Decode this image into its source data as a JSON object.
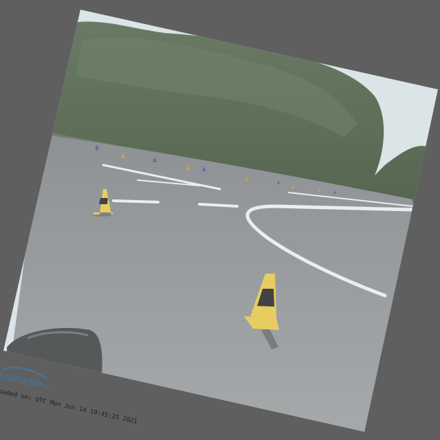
{
  "photo": {
    "subject": "driving-track-with-traffic-cones",
    "watermark_logo_text": "ecurieaix",
    "watermark_logo_tagline": "",
    "timestamp_text": "oaded on:  UTC  Mon Jun 14 19:45:25 2021"
  },
  "colors": {
    "background": "#5f5f5f",
    "asphalt": "#8d9194",
    "sky": "#d7e2e6",
    "trees": "#4b6145",
    "cone_yellow": "#e4c64a",
    "cone_band": "#2a2a2a",
    "cone_blue": "#3f5fa3",
    "logo_blue": "#3d78a8"
  }
}
